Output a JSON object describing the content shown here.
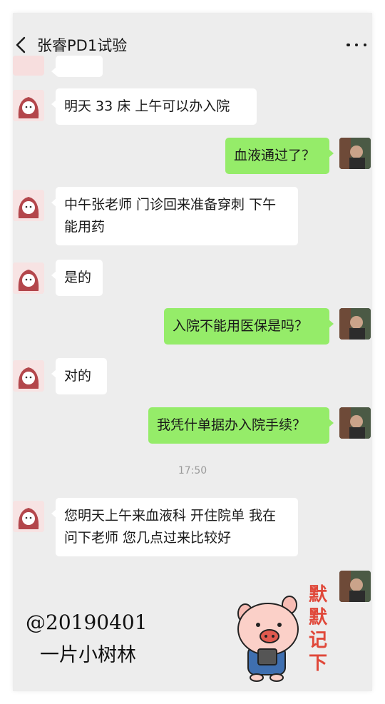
{
  "header": {
    "title": "张睿PD1试验",
    "back_icon": "chevron-left-icon",
    "more_icon": "more-dots-icon"
  },
  "messages": [
    {
      "sender": "other",
      "text": "明天 33 床 上午可以办入院"
    },
    {
      "sender": "me",
      "text": "血液通过了？"
    },
    {
      "sender": "other",
      "text": "中午张老师 门诊回来准备穿刺 下午能用药"
    },
    {
      "sender": "other",
      "text": "是的"
    },
    {
      "sender": "me",
      "text": "入院不能用医保是吗？"
    },
    {
      "sender": "other",
      "text": "对的"
    },
    {
      "sender": "me",
      "text": "我凭什单据办入院手续？"
    },
    {
      "sender": "other",
      "text": "您明天上午来血液科 开住院单 我在问下老师 您几点过来比较好"
    }
  ],
  "timestamp": "17:50",
  "watermark": {
    "line1": "@20190401",
    "line2": "一片小树林"
  },
  "sticker": {
    "text_lines": [
      "默",
      "默",
      "记",
      "下"
    ],
    "icon": "pig-sticker-icon"
  },
  "colors": {
    "background": "#ededed",
    "bubble_me": "#95ec69",
    "bubble_other": "#ffffff",
    "sticker_text": "#e0483a"
  }
}
